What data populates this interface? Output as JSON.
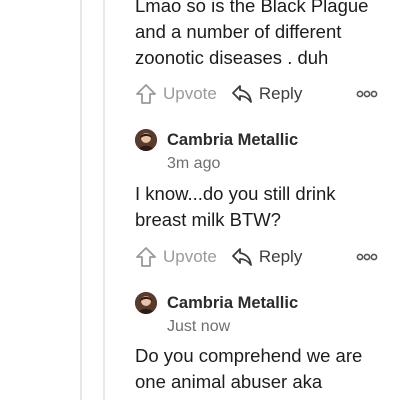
{
  "comments": [
    {
      "text": "Lmao so is the Black Plague\nand a number of different\nzoonotic diseases . duh",
      "upvote_label": "Upvote",
      "reply_label": "Reply"
    },
    {
      "author": "Cambria Metallic",
      "time": "3m ago",
      "text": "I know...do you still drink\nbreast milk BTW?",
      "upvote_label": "Upvote",
      "reply_label": "Reply"
    },
    {
      "author": "Cambria Metallic",
      "time": "Just now",
      "text": "Do you comprehend we are\none animal abuser aka"
    }
  ],
  "icons": {
    "upvote": "upvote-arrow-icon",
    "reply": "reply-arrow-icon",
    "more": "more-options-icon",
    "avatar": "user-avatar"
  },
  "colors": {
    "upvote_gray": "#9a9a9a",
    "reply_dark": "#3d3d3d",
    "time_gray": "#6f6f6f",
    "thread_line": "#e8e8e8"
  }
}
